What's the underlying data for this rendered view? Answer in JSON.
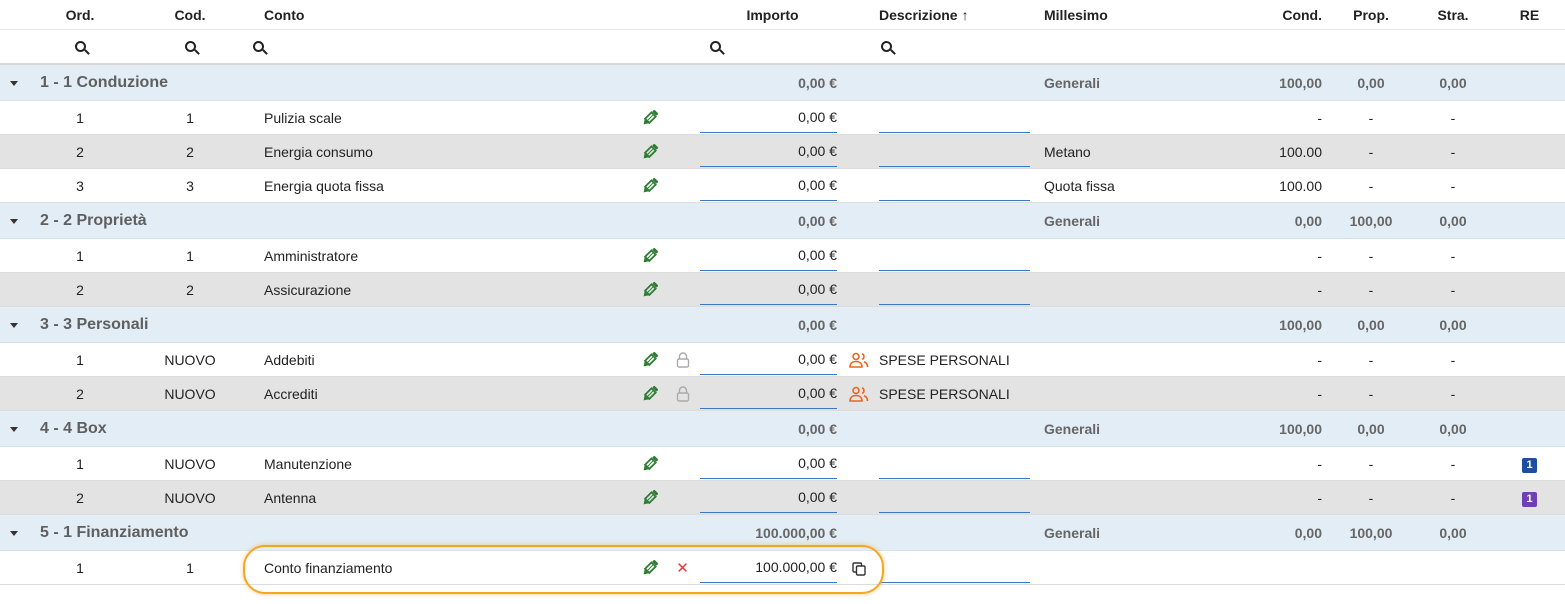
{
  "columns": {
    "ord": "Ord.",
    "cod": "Cod.",
    "conto": "Conto",
    "importo": "Importo",
    "descrizione": "Descrizione",
    "descrizione_sort": "↑",
    "millesimo": "Millesimo",
    "cond": "Cond.",
    "prop": "Prop.",
    "stra": "Stra.",
    "re": "RE"
  },
  "groups": [
    {
      "title": "1 - 1 Conduzione",
      "importo": "0,00 €",
      "millesimo": "Generali",
      "cond": "100,00",
      "prop": "0,00",
      "stra": "0,00",
      "rows": [
        {
          "ord": "1",
          "cod": "1",
          "conto": "Pulizia scale",
          "importo": "0,00 €",
          "millesimo": "",
          "cond": "-",
          "prop": "-",
          "stra": "-"
        },
        {
          "ord": "2",
          "cod": "2",
          "conto": "Energia consumo",
          "importo": "0,00 €",
          "millesimo": "Metano",
          "cond": "100.00",
          "prop": "-",
          "stra": "-"
        },
        {
          "ord": "3",
          "cod": "3",
          "conto": "Energia quota fissa",
          "importo": "0,00 €",
          "millesimo": "Quota fissa",
          "cond": "100.00",
          "prop": "-",
          "stra": "-"
        }
      ]
    },
    {
      "title": "2 - 2 Proprietà",
      "importo": "0,00 €",
      "millesimo": "Generali",
      "cond": "0,00",
      "prop": "100,00",
      "stra": "0,00",
      "rows": [
        {
          "ord": "1",
          "cod": "1",
          "conto": "Amministratore",
          "importo": "0,00 €",
          "millesimo": "",
          "cond": "-",
          "prop": "-",
          "stra": "-"
        },
        {
          "ord": "2",
          "cod": "2",
          "conto": "Assicurazione",
          "importo": "0,00 €",
          "millesimo": "",
          "cond": "-",
          "prop": "-",
          "stra": "-"
        }
      ]
    },
    {
      "title": "3 - 3 Personali",
      "importo": "0,00 €",
      "millesimo": "",
      "cond": "100,00",
      "prop": "0,00",
      "stra": "0,00",
      "rows": [
        {
          "ord": "1",
          "cod": "NUOVO",
          "conto": "Addebiti",
          "importo": "0,00 €",
          "descrizione": "SPESE PERSONALI",
          "cond": "-",
          "prop": "-",
          "stra": "-"
        },
        {
          "ord": "2",
          "cod": "NUOVO",
          "conto": "Accrediti",
          "importo": "0,00 €",
          "descrizione": "SPESE PERSONALI",
          "cond": "-",
          "prop": "-",
          "stra": "-"
        }
      ]
    },
    {
      "title": "4 - 4 Box",
      "importo": "0,00 €",
      "millesimo": "Generali",
      "cond": "100,00",
      "prop": "0,00",
      "stra": "0,00",
      "rows": [
        {
          "ord": "1",
          "cod": "NUOVO",
          "conto": "Manutenzione",
          "importo": "0,00 €",
          "millesimo": "",
          "cond": "-",
          "prop": "-",
          "stra": "-",
          "re": "1",
          "re_color": "#1e4f9c"
        },
        {
          "ord": "2",
          "cod": "NUOVO",
          "conto": "Antenna",
          "importo": "0,00 €",
          "millesimo": "",
          "cond": "-",
          "prop": "-",
          "stra": "-",
          "re": "1",
          "re_color": "#6f3fb5"
        }
      ]
    },
    {
      "title": "5 - 1 Finanziamento",
      "importo": "100.000,00 €",
      "millesimo": "Generali",
      "cond": "0,00",
      "prop": "100,00",
      "stra": "0,00",
      "rows": [
        {
          "ord": "1",
          "cod": "1",
          "conto": "Conto finanziamento",
          "importo": "100.000,00 €"
        }
      ]
    }
  ],
  "colors": {
    "group_bg": "#e2edf5",
    "pencil": "#2e7d32",
    "people_icon": "#e8671c",
    "field_underline": "#3b78c4",
    "highlight": "#f5a623",
    "delete_x": "#e53935"
  }
}
